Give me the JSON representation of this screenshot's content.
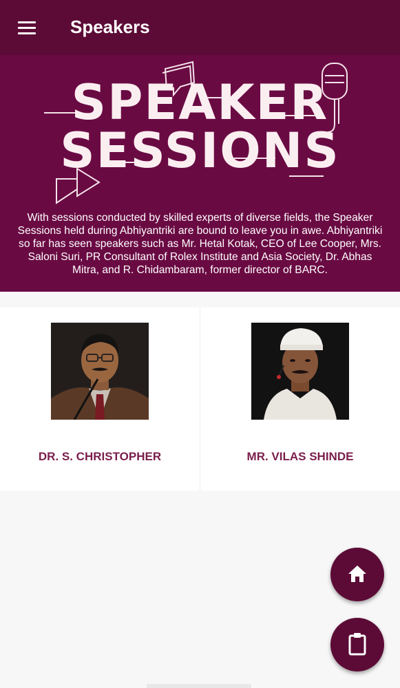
{
  "appbar": {
    "title": "Speakers",
    "menu_icon": "hamburger-menu-icon"
  },
  "banner": {
    "headline_line1": "SPEAKER",
    "headline_line2": "SESSIONS",
    "description": "With sessions conducted by skilled experts of diverse fields, the Speaker Sessions held during Abhiyantriki are bound to leave you in awe. Abhiyantriki so far has seen speakers such as Mr. Hetal Kotak, CEO of Lee Cooper, Mrs. Saloni Suri, PR Consultant of Rolex Institute and Asia Society, Dr. Abhas Mitra, and R. Chidambaram, former director of BARC."
  },
  "speakers": [
    {
      "name": "DR. S. CHRISTOPHER"
    },
    {
      "name": "MR. VILAS SHINDE"
    }
  ],
  "fabs": {
    "home_icon": "home-icon",
    "clipboard_icon": "clipboard-icon"
  },
  "colors": {
    "appbar": "#5c0b36",
    "banner": "#6a0a43",
    "accent_text": "#7a1e4c",
    "fab": "#5c0b36"
  }
}
